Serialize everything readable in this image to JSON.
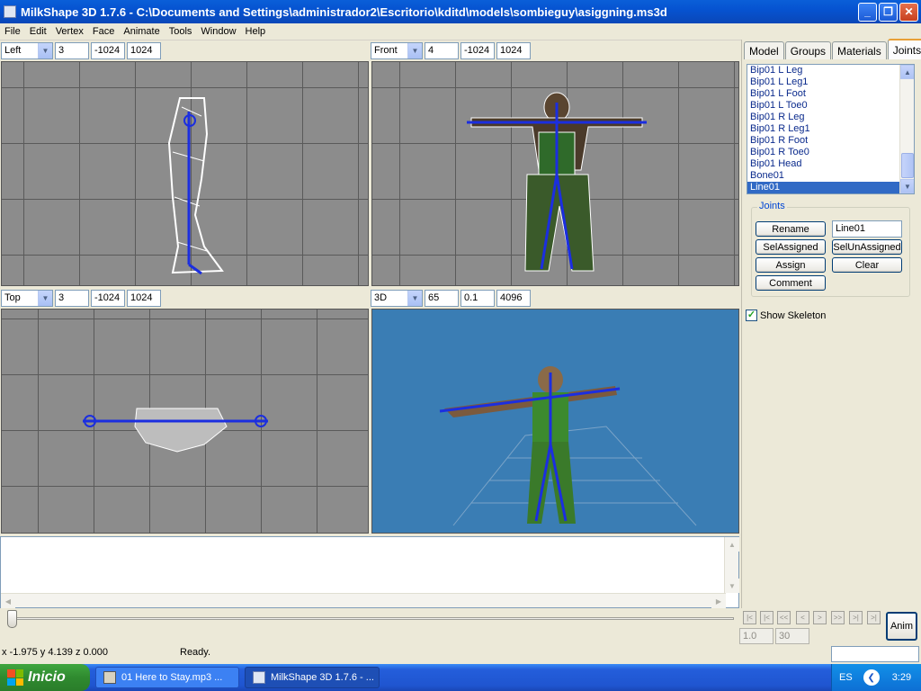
{
  "window": {
    "title": "MilkShape 3D 1.7.6 - C:\\Documents and Settings\\administrador2\\Escritorio\\kditd\\models\\sombieguy\\asiggning.ms3d"
  },
  "menu": [
    "File",
    "Edit",
    "Vertex",
    "Face",
    "Animate",
    "Tools",
    "Window",
    "Help"
  ],
  "viewports": [
    {
      "view": "Left",
      "a": "3",
      "b": "-1024",
      "c": "1024"
    },
    {
      "view": "Front",
      "a": "4",
      "b": "-1024",
      "c": "1024"
    },
    {
      "view": "Top",
      "a": "3",
      "b": "-1024",
      "c": "1024"
    },
    {
      "view": "3D",
      "a": "65",
      "b": "0.1",
      "c": "4096"
    }
  ],
  "tabs": [
    "Model",
    "Groups",
    "Materials",
    "Joints"
  ],
  "active_tab": "Joints",
  "joints": [
    "Bip01 L Leg",
    "Bip01 L Leg1",
    "Bip01 L Foot",
    "Bip01 L Toe0",
    "Bip01 R Leg",
    "Bip01 R Leg1",
    "Bip01 R Foot",
    "Bip01 R Toe0",
    "Bip01 Head",
    "Bone01",
    "Line01"
  ],
  "selected_joint": "Line01",
  "joints_group": {
    "legend": "Joints",
    "rename": "Rename",
    "name_value": "Line01",
    "sel_assigned": "SelAssigned",
    "sel_unassigned": "SelUnAssigned",
    "assign": "Assign",
    "clear": "Clear",
    "comment": "Comment"
  },
  "show_skeleton": {
    "label": "Show Skeleton",
    "checked": true
  },
  "timeline": {
    "frame_start": "1.0",
    "frame_end": "30",
    "anim": "Anim",
    "buttons": [
      "|<",
      "|<",
      "<<",
      "<",
      ">",
      ">>",
      ">|",
      ">|"
    ]
  },
  "status": {
    "coords": "x -1.975 y 4.139 z 0.000",
    "message": "Ready."
  },
  "taskbar": {
    "start": "Inicio",
    "tasks": [
      "01 Here to Stay.mp3 ...",
      "MilkShape 3D 1.7.6 - ..."
    ],
    "lang": "ES",
    "clock": "3:29"
  }
}
